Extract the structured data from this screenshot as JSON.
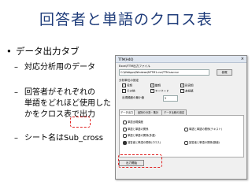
{
  "slide": {
    "title": "回答者と単語のクロス表",
    "bullet1": "データ出力タブ",
    "sub1": "対応分析用のデータ",
    "sub2_line1": "回答者がそれぞれの",
    "sub2_line2": "単語をどれほど使用した",
    "sub2_line3": "かをクロス表で出力",
    "sub3": "シート名はSub_cross"
  },
  "dialog": {
    "title": "TTM(H40)",
    "close": "×",
    "file_group_label": "Excel/TTM出力ファイル",
    "file_path": "C:\\WdApps\\Windows\\NTTM1.csv\\TTM.sav.csv",
    "browse_label": "参照",
    "analysis_label": "分析単位の設定",
    "check_noun": "名詞",
    "check_verb": "動詞",
    "check_adj": "形容詞",
    "check_other": "その他",
    "check_keyword": "キーワード",
    "check_unknown": "未知語",
    "min_freq_label": "出現頻度の最小値",
    "min_freq_value": "5",
    "tabs": [
      "データ出力",
      "品詞の分割・集計",
      "データ比較の設定"
    ],
    "out_options": [
      "単語出現頻度",
      "単語と単語の関係",
      "単語と単語の関係(テキスト)",
      "単語と単語の関係(多重)",
      "回答者と単語の関係(クロス)",
      "回答者と単語の関係(数値)"
    ],
    "bottom_button": "出力開始"
  }
}
